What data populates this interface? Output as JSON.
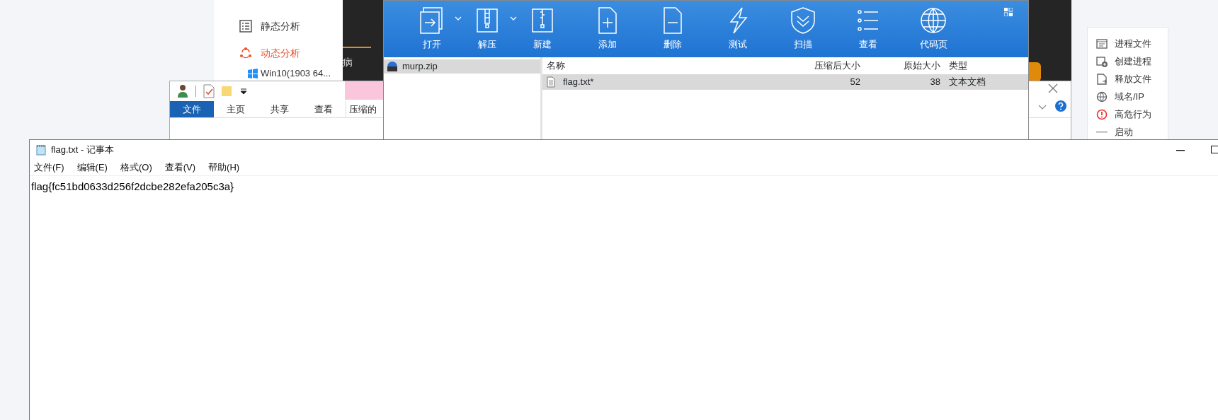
{
  "web_page": {
    "sidebar_items": [
      {
        "label": "静态分析",
        "selected": false
      },
      {
        "label": "动态分析",
        "selected": true
      }
    ],
    "vm_item": "Win10(1903 64...",
    "partial_tab": "病",
    "behavior_legend": [
      "进程文件",
      "创建进程",
      "释放文件",
      "域名/IP",
      "高危行为",
      "启动"
    ]
  },
  "explorer": {
    "tabs": [
      {
        "label": "文件",
        "selected": true
      },
      {
        "label": "主页",
        "selected": false
      },
      {
        "label": "共享",
        "selected": false
      },
      {
        "label": "查看",
        "selected": false
      },
      {
        "label": "压缩的",
        "selected": false
      }
    ]
  },
  "archive": {
    "toolbar": [
      "打开",
      "解压",
      "新建",
      "添加",
      "删除",
      "测试",
      "扫描",
      "查看",
      "代码页"
    ],
    "tree": [
      {
        "label": "murp.zip",
        "selected": true
      }
    ],
    "columns": [
      "名称",
      "压缩后大小",
      "原始大小",
      "类型"
    ],
    "rows": [
      {
        "cells": [
          "flag.txt*",
          "52",
          "38",
          "文本文档"
        ],
        "selected": true
      }
    ]
  },
  "notepad": {
    "title": "flag.txt - 记事本",
    "menu": [
      "文件(F)",
      "编辑(E)",
      "格式(O)",
      "查看(V)",
      "帮助(H)"
    ],
    "content": "flag{fc51bd0633d256f2dcbe282efa205c3a}"
  }
}
